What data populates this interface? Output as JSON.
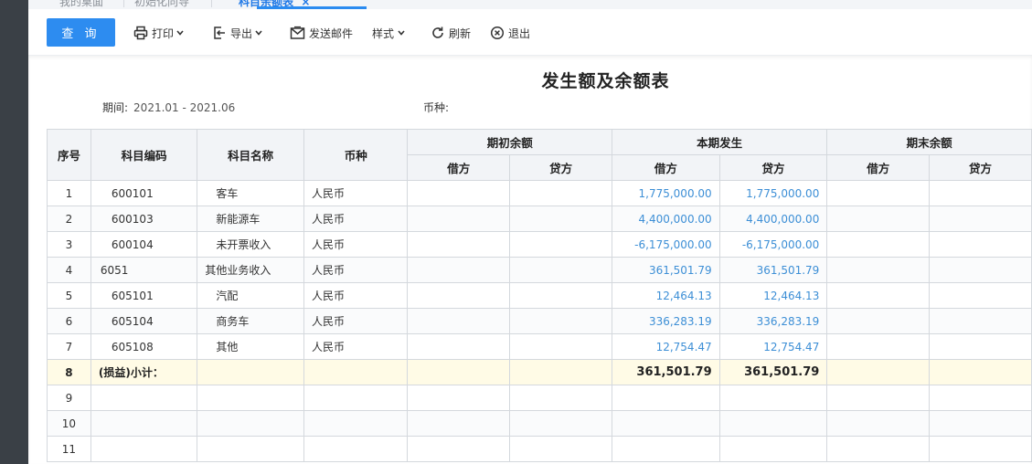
{
  "tabs": [
    {
      "label": "我的桌面"
    },
    {
      "label": "初始化向导"
    },
    {
      "label": "科目余额表",
      "close": "×"
    }
  ],
  "toolbar": {
    "query": "查 询",
    "print": "打印",
    "export": "导出",
    "email": "发送邮件",
    "style": "样式",
    "refresh": "刷新",
    "exit": "退出"
  },
  "report": {
    "title": "发生额及余额表",
    "period_label": "期间:",
    "period_value": "2021.01 - 2021.06",
    "currency_label": "币种:",
    "currency_value": ""
  },
  "table": {
    "headers": {
      "seq": "序号",
      "code": "科目编码",
      "name": "科目名称",
      "currency": "币种",
      "opening": "期初余额",
      "current": "本期发生",
      "closing": "期末余额",
      "debit": "借方",
      "credit": "贷方"
    },
    "rows": [
      {
        "seq": "1",
        "code": "600101",
        "name": "客车",
        "currency": "人民币",
        "cur_debit": "1,775,000.00",
        "cur_credit": "1,775,000.00"
      },
      {
        "seq": "2",
        "code": "600103",
        "name": "新能源车",
        "currency": "人民币",
        "cur_debit": "4,400,000.00",
        "cur_credit": "4,400,000.00"
      },
      {
        "seq": "3",
        "code": "600104",
        "name": "未开票收入",
        "currency": "人民币",
        "cur_debit": "-6,175,000.00",
        "cur_credit": "-6,175,000.00"
      },
      {
        "seq": "4",
        "code": "6051",
        "name": "其他业务收入",
        "currency": "人民币",
        "cur_debit": "361,501.79",
        "cur_credit": "361,501.79"
      },
      {
        "seq": "5",
        "code": "605101",
        "name": "汽配",
        "currency": "人民币",
        "cur_debit": "12,464.13",
        "cur_credit": "12,464.13"
      },
      {
        "seq": "6",
        "code": "605104",
        "name": "商务车",
        "currency": "人民币",
        "cur_debit": "336,283.19",
        "cur_credit": "336,283.19"
      },
      {
        "seq": "7",
        "code": "605108",
        "name": "其他",
        "currency": "人民币",
        "cur_debit": "12,754.47",
        "cur_credit": "12,754.47"
      }
    ],
    "subtotal": {
      "seq": "8",
      "label": "(损益)小计：",
      "cur_debit": "361,501.79",
      "cur_credit": "361,501.79"
    },
    "empty_rows": [
      "9",
      "10",
      "11"
    ]
  },
  "colors": {
    "accent": "#2d8cf0",
    "amount_blue": "#3d8fd6",
    "subtotal_bg": "#fffbe6"
  }
}
